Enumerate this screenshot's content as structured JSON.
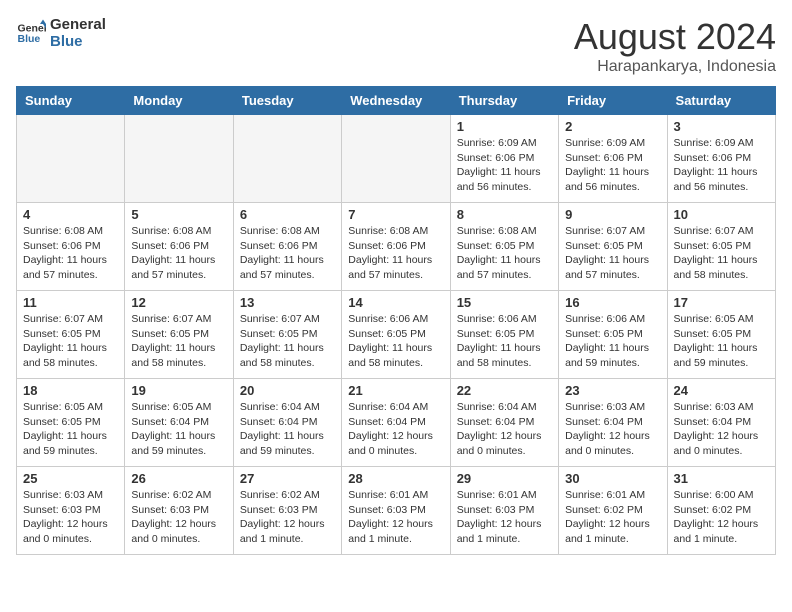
{
  "header": {
    "logo_line1": "General",
    "logo_line2": "Blue",
    "month_year": "August 2024",
    "location": "Harapankarya, Indonesia"
  },
  "weekdays": [
    "Sunday",
    "Monday",
    "Tuesday",
    "Wednesday",
    "Thursday",
    "Friday",
    "Saturday"
  ],
  "weeks": [
    [
      {
        "day": "",
        "info": ""
      },
      {
        "day": "",
        "info": ""
      },
      {
        "day": "",
        "info": ""
      },
      {
        "day": "",
        "info": ""
      },
      {
        "day": "1",
        "info": "Sunrise: 6:09 AM\nSunset: 6:06 PM\nDaylight: 11 hours\nand 56 minutes."
      },
      {
        "day": "2",
        "info": "Sunrise: 6:09 AM\nSunset: 6:06 PM\nDaylight: 11 hours\nand 56 minutes."
      },
      {
        "day": "3",
        "info": "Sunrise: 6:09 AM\nSunset: 6:06 PM\nDaylight: 11 hours\nand 56 minutes."
      }
    ],
    [
      {
        "day": "4",
        "info": "Sunrise: 6:08 AM\nSunset: 6:06 PM\nDaylight: 11 hours\nand 57 minutes."
      },
      {
        "day": "5",
        "info": "Sunrise: 6:08 AM\nSunset: 6:06 PM\nDaylight: 11 hours\nand 57 minutes."
      },
      {
        "day": "6",
        "info": "Sunrise: 6:08 AM\nSunset: 6:06 PM\nDaylight: 11 hours\nand 57 minutes."
      },
      {
        "day": "7",
        "info": "Sunrise: 6:08 AM\nSunset: 6:06 PM\nDaylight: 11 hours\nand 57 minutes."
      },
      {
        "day": "8",
        "info": "Sunrise: 6:08 AM\nSunset: 6:05 PM\nDaylight: 11 hours\nand 57 minutes."
      },
      {
        "day": "9",
        "info": "Sunrise: 6:07 AM\nSunset: 6:05 PM\nDaylight: 11 hours\nand 57 minutes."
      },
      {
        "day": "10",
        "info": "Sunrise: 6:07 AM\nSunset: 6:05 PM\nDaylight: 11 hours\nand 58 minutes."
      }
    ],
    [
      {
        "day": "11",
        "info": "Sunrise: 6:07 AM\nSunset: 6:05 PM\nDaylight: 11 hours\nand 58 minutes."
      },
      {
        "day": "12",
        "info": "Sunrise: 6:07 AM\nSunset: 6:05 PM\nDaylight: 11 hours\nand 58 minutes."
      },
      {
        "day": "13",
        "info": "Sunrise: 6:07 AM\nSunset: 6:05 PM\nDaylight: 11 hours\nand 58 minutes."
      },
      {
        "day": "14",
        "info": "Sunrise: 6:06 AM\nSunset: 6:05 PM\nDaylight: 11 hours\nand 58 minutes."
      },
      {
        "day": "15",
        "info": "Sunrise: 6:06 AM\nSunset: 6:05 PM\nDaylight: 11 hours\nand 58 minutes."
      },
      {
        "day": "16",
        "info": "Sunrise: 6:06 AM\nSunset: 6:05 PM\nDaylight: 11 hours\nand 59 minutes."
      },
      {
        "day": "17",
        "info": "Sunrise: 6:05 AM\nSunset: 6:05 PM\nDaylight: 11 hours\nand 59 minutes."
      }
    ],
    [
      {
        "day": "18",
        "info": "Sunrise: 6:05 AM\nSunset: 6:05 PM\nDaylight: 11 hours\nand 59 minutes."
      },
      {
        "day": "19",
        "info": "Sunrise: 6:05 AM\nSunset: 6:04 PM\nDaylight: 11 hours\nand 59 minutes."
      },
      {
        "day": "20",
        "info": "Sunrise: 6:04 AM\nSunset: 6:04 PM\nDaylight: 11 hours\nand 59 minutes."
      },
      {
        "day": "21",
        "info": "Sunrise: 6:04 AM\nSunset: 6:04 PM\nDaylight: 12 hours\nand 0 minutes."
      },
      {
        "day": "22",
        "info": "Sunrise: 6:04 AM\nSunset: 6:04 PM\nDaylight: 12 hours\nand 0 minutes."
      },
      {
        "day": "23",
        "info": "Sunrise: 6:03 AM\nSunset: 6:04 PM\nDaylight: 12 hours\nand 0 minutes."
      },
      {
        "day": "24",
        "info": "Sunrise: 6:03 AM\nSunset: 6:04 PM\nDaylight: 12 hours\nand 0 minutes."
      }
    ],
    [
      {
        "day": "25",
        "info": "Sunrise: 6:03 AM\nSunset: 6:03 PM\nDaylight: 12 hours\nand 0 minutes."
      },
      {
        "day": "26",
        "info": "Sunrise: 6:02 AM\nSunset: 6:03 PM\nDaylight: 12 hours\nand 0 minutes."
      },
      {
        "day": "27",
        "info": "Sunrise: 6:02 AM\nSunset: 6:03 PM\nDaylight: 12 hours\nand 1 minute."
      },
      {
        "day": "28",
        "info": "Sunrise: 6:01 AM\nSunset: 6:03 PM\nDaylight: 12 hours\nand 1 minute."
      },
      {
        "day": "29",
        "info": "Sunrise: 6:01 AM\nSunset: 6:03 PM\nDaylight: 12 hours\nand 1 minute."
      },
      {
        "day": "30",
        "info": "Sunrise: 6:01 AM\nSunset: 6:02 PM\nDaylight: 12 hours\nand 1 minute."
      },
      {
        "day": "31",
        "info": "Sunrise: 6:00 AM\nSunset: 6:02 PM\nDaylight: 12 hours\nand 1 minute."
      }
    ]
  ]
}
